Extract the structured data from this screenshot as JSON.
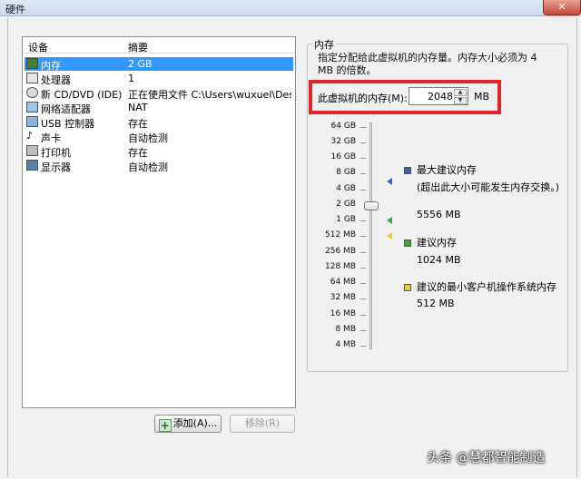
{
  "window": {
    "title": "硬件",
    "close_glyph": "✕"
  },
  "devices": {
    "col_device": "设备",
    "col_summary": "摘要",
    "items": [
      {
        "name": "内存",
        "summary": "2 GB",
        "icon": "memory-icon",
        "selected": true
      },
      {
        "name": "处理器",
        "summary": "1",
        "icon": "cpu-icon",
        "selected": false
      },
      {
        "name": "新 CD/DVD (IDE)",
        "summary": "正在使用文件 C:\\Users\\wuxuel\\Des...",
        "icon": "cd-icon",
        "selected": false
      },
      {
        "name": "网络适配器",
        "summary": "NAT",
        "icon": "network-icon",
        "selected": false
      },
      {
        "name": "USB 控制器",
        "summary": "存在",
        "icon": "usb-icon",
        "selected": false
      },
      {
        "name": "声卡",
        "summary": "自动检测",
        "icon": "sound-icon",
        "selected": false
      },
      {
        "name": "打印机",
        "summary": "存在",
        "icon": "printer-icon",
        "selected": false
      },
      {
        "name": "显示器",
        "summary": "自动检测",
        "icon": "display-icon",
        "selected": false
      }
    ],
    "add_button": "添加(A)...",
    "remove_button": "移除(R)"
  },
  "memory": {
    "group_title": "内存",
    "description": "指定分配给此虚拟机的内存量。内存大小必须为 4 MB 的倍数。",
    "field_label": "此虚拟机的内存(M):",
    "value": "2048",
    "unit": "MB",
    "scale_ticks": [
      "64 GB",
      "32 GB",
      "16 GB",
      "8 GB",
      "4 GB",
      "2 GB",
      "1 GB",
      "512 MB",
      "256 MB",
      "128 MB",
      "64 MB",
      "32 MB",
      "16 MB",
      "8 MB",
      "4 MB"
    ],
    "legend": {
      "max_title": "最大建议内存",
      "max_note": "(超出此大小可能发生内存交换。)",
      "max_value": "5556 MB",
      "rec_title": "建议内存",
      "rec_value": "1024 MB",
      "min_title": "建议的最小客户机操作系统内存",
      "min_value": "512 MB"
    },
    "colors": {
      "max": "#3b5fb4",
      "rec": "#38a838",
      "min": "#e5d32a"
    }
  },
  "watermark": "头条 @慧都智能制造"
}
